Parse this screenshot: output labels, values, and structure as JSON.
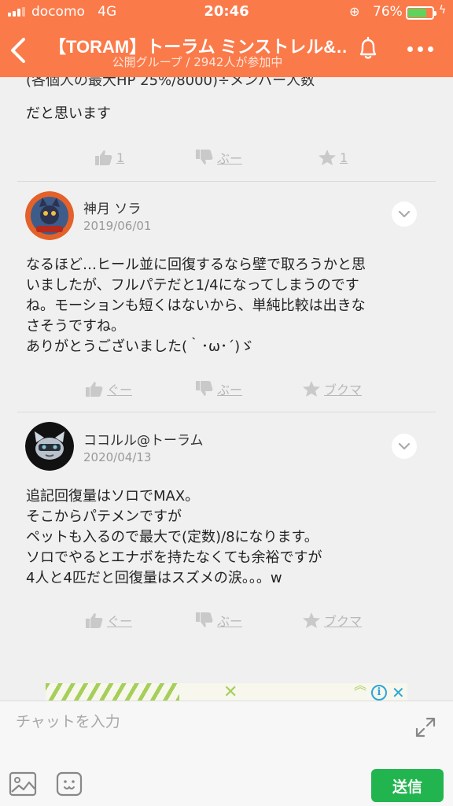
{
  "status_bar": {
    "carrier": "docomo",
    "network": "4G",
    "time": "20:46",
    "battery_percent": "76%",
    "battery_level": 0.76
  },
  "header": {
    "title": "【TORAM】トーラム ミンストレル&…",
    "subtitle": "公開グループ / 2942人が参加中"
  },
  "feed": {
    "clipped_text": "(各個人の最大HP 25%/8000)÷メンバー人数",
    "prev_comment": {
      "last_line": "だと思います",
      "like_count": "1",
      "dislike_label": "ぶー",
      "favorite_count": "1"
    },
    "comments": [
      {
        "author": "神月 ソラ",
        "date": "2019/06/01",
        "lines": [
          "なるほど…ヒール並に回復するなら壁で取ろうかと思",
          "いましたが、フルパテだと1/4になってしまうのです",
          "ね。モーションも短くはないから、単純比較は出きな",
          "さそうですね。",
          "ありがとうございました(｀･ω･´)ゞ"
        ],
        "like_label": "ぐー",
        "dislike_label": "ぶー",
        "bookmark_label": "ブクマ"
      },
      {
        "author": "ココルル@トーラム",
        "date": "2020/04/13",
        "lines": [
          "追記回復量はソロでMAX。",
          "そこからパテメンですが",
          "ペットも入るので最大で(定数)/8になります。",
          "ソロでやるとエナボを持たなくても余裕ですが",
          "4人と4匹だと回復量はスズメの涙。。。w"
        ],
        "like_label": "ぐー",
        "dislike_label": "ぶー",
        "bookmark_label": "ブクマ"
      }
    ]
  },
  "ad": {
    "info_glyph": "i",
    "close_glyph": "✕"
  },
  "compose": {
    "placeholder": "チャットを入力",
    "send_label": "送信"
  },
  "colors": {
    "header_bg": "#fb7a4a",
    "send_button": "#22b54f",
    "battery_fill": "#5fd35d",
    "ad_accent": "#2aa6d6"
  },
  "icons": [
    "back-chevron-icon",
    "bell-icon",
    "more-dots-icon",
    "thumbs-up-icon",
    "thumbs-down-icon",
    "star-icon",
    "chevron-down-icon",
    "expand-icon",
    "image-icon",
    "sticker-icon"
  ]
}
